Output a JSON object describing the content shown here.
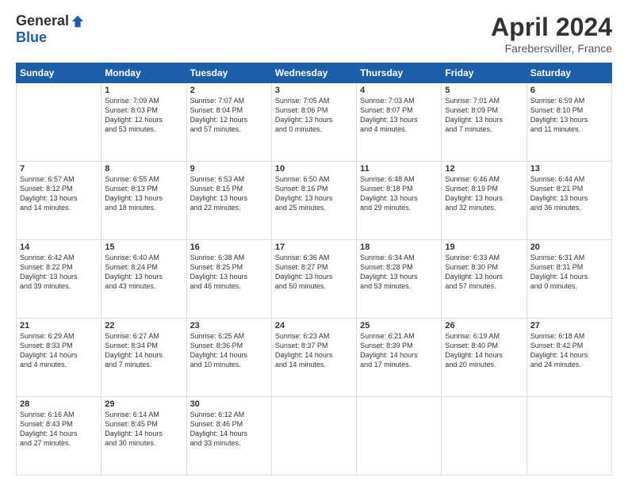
{
  "header": {
    "logo_general": "General",
    "logo_blue": "Blue",
    "title": "April 2024",
    "subtitle": "Farebersviller, France"
  },
  "calendar": {
    "days_of_week": [
      "Sunday",
      "Monday",
      "Tuesday",
      "Wednesday",
      "Thursday",
      "Friday",
      "Saturday"
    ],
    "weeks": [
      [
        {
          "date": "",
          "info": ""
        },
        {
          "date": "1",
          "info": "Sunrise: 7:09 AM\nSunset: 8:03 PM\nDaylight: 12 hours\nand 53 minutes."
        },
        {
          "date": "2",
          "info": "Sunrise: 7:07 AM\nSunset: 8:04 PM\nDaylight: 12 hours\nand 57 minutes."
        },
        {
          "date": "3",
          "info": "Sunrise: 7:05 AM\nSunset: 8:06 PM\nDaylight: 13 hours\nand 0 minutes."
        },
        {
          "date": "4",
          "info": "Sunrise: 7:03 AM\nSunset: 8:07 PM\nDaylight: 13 hours\nand 4 minutes."
        },
        {
          "date": "5",
          "info": "Sunrise: 7:01 AM\nSunset: 8:09 PM\nDaylight: 13 hours\nand 7 minutes."
        },
        {
          "date": "6",
          "info": "Sunrise: 6:59 AM\nSunset: 8:10 PM\nDaylight: 13 hours\nand 11 minutes."
        }
      ],
      [
        {
          "date": "7",
          "info": "Sunrise: 6:57 AM\nSunset: 8:12 PM\nDaylight: 13 hours\nand 14 minutes."
        },
        {
          "date": "8",
          "info": "Sunrise: 6:55 AM\nSunset: 8:13 PM\nDaylight: 13 hours\nand 18 minutes."
        },
        {
          "date": "9",
          "info": "Sunrise: 6:53 AM\nSunset: 8:15 PM\nDaylight: 13 hours\nand 22 minutes."
        },
        {
          "date": "10",
          "info": "Sunrise: 6:50 AM\nSunset: 8:16 PM\nDaylight: 13 hours\nand 25 minutes."
        },
        {
          "date": "11",
          "info": "Sunrise: 6:48 AM\nSunset: 8:18 PM\nDaylight: 13 hours\nand 29 minutes."
        },
        {
          "date": "12",
          "info": "Sunrise: 6:46 AM\nSunset: 8:19 PM\nDaylight: 13 hours\nand 32 minutes."
        },
        {
          "date": "13",
          "info": "Sunrise: 6:44 AM\nSunset: 8:21 PM\nDaylight: 13 hours\nand 36 minutes."
        }
      ],
      [
        {
          "date": "14",
          "info": "Sunrise: 6:42 AM\nSunset: 8:22 PM\nDaylight: 13 hours\nand 39 minutes."
        },
        {
          "date": "15",
          "info": "Sunrise: 6:40 AM\nSunset: 8:24 PM\nDaylight: 13 hours\nand 43 minutes."
        },
        {
          "date": "16",
          "info": "Sunrise: 6:38 AM\nSunset: 8:25 PM\nDaylight: 13 hours\nand 46 minutes."
        },
        {
          "date": "17",
          "info": "Sunrise: 6:36 AM\nSunset: 8:27 PM\nDaylight: 13 hours\nand 50 minutes."
        },
        {
          "date": "18",
          "info": "Sunrise: 6:34 AM\nSunset: 8:28 PM\nDaylight: 13 hours\nand 53 minutes."
        },
        {
          "date": "19",
          "info": "Sunrise: 6:33 AM\nSunset: 8:30 PM\nDaylight: 13 hours\nand 57 minutes."
        },
        {
          "date": "20",
          "info": "Sunrise: 6:31 AM\nSunset: 8:31 PM\nDaylight: 14 hours\nand 0 minutes."
        }
      ],
      [
        {
          "date": "21",
          "info": "Sunrise: 6:29 AM\nSunset: 8:33 PM\nDaylight: 14 hours\nand 4 minutes."
        },
        {
          "date": "22",
          "info": "Sunrise: 6:27 AM\nSunset: 8:34 PM\nDaylight: 14 hours\nand 7 minutes."
        },
        {
          "date": "23",
          "info": "Sunrise: 6:25 AM\nSunset: 8:36 PM\nDaylight: 14 hours\nand 10 minutes."
        },
        {
          "date": "24",
          "info": "Sunrise: 6:23 AM\nSunset: 8:37 PM\nDaylight: 14 hours\nand 14 minutes."
        },
        {
          "date": "25",
          "info": "Sunrise: 6:21 AM\nSunset: 8:39 PM\nDaylight: 14 hours\nand 17 minutes."
        },
        {
          "date": "26",
          "info": "Sunrise: 6:19 AM\nSunset: 8:40 PM\nDaylight: 14 hours\nand 20 minutes."
        },
        {
          "date": "27",
          "info": "Sunrise: 6:18 AM\nSunset: 8:42 PM\nDaylight: 14 hours\nand 24 minutes."
        }
      ],
      [
        {
          "date": "28",
          "info": "Sunrise: 6:16 AM\nSunset: 8:43 PM\nDaylight: 14 hours\nand 27 minutes."
        },
        {
          "date": "29",
          "info": "Sunrise: 6:14 AM\nSunset: 8:45 PM\nDaylight: 14 hours\nand 30 minutes."
        },
        {
          "date": "30",
          "info": "Sunrise: 6:12 AM\nSunset: 8:46 PM\nDaylight: 14 hours\nand 33 minutes."
        },
        {
          "date": "",
          "info": ""
        },
        {
          "date": "",
          "info": ""
        },
        {
          "date": "",
          "info": ""
        },
        {
          "date": "",
          "info": ""
        }
      ]
    ]
  }
}
